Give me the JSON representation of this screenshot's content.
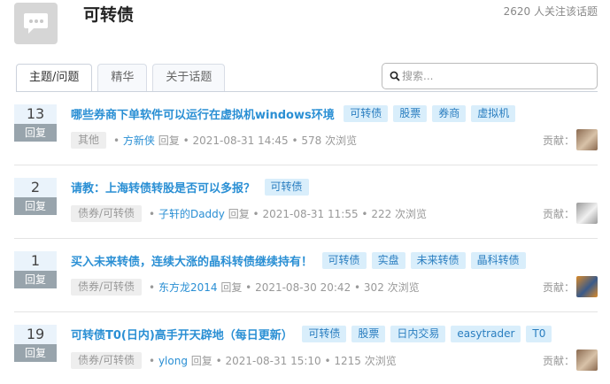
{
  "header": {
    "title": "可转债",
    "followers": "2620 人关注该话题",
    "icon": "chat-bubble-icon"
  },
  "tabs": [
    {
      "label": "主题/问题",
      "active": true
    },
    {
      "label": "精华",
      "active": false
    },
    {
      "label": "关于话题",
      "active": false
    }
  ],
  "search": {
    "placeholder": "搜索..."
  },
  "questions": [
    {
      "count": "13",
      "count_label": "回复",
      "title": "哪些券商下单软件可以运行在虚拟机windows环境",
      "tags": [
        "可转债",
        "股票",
        "券商",
        "虚拟机"
      ],
      "category": "其他",
      "author": "方新侠",
      "action": "回复",
      "time": "2021-08-31 14:45",
      "views": "578 次浏览",
      "contrib_label": "贡献：",
      "avatar_colors": [
        "#8a6a50",
        "#d8c2a8"
      ]
    },
    {
      "count": "2",
      "count_label": "回复",
      "title": "请教：上海转债转股是否可以多报？",
      "tags": [
        "可转债"
      ],
      "category": "债券/可转债",
      "author": "子轩的Daddy",
      "action": "回复",
      "time": "2021-08-31 11:55",
      "views": "222 次浏览",
      "contrib_label": "贡献：",
      "avatar_colors": [
        "#9a9a9a",
        "#f0f0f0"
      ]
    },
    {
      "count": "1",
      "count_label": "回复",
      "title": "买入未来转债，连续大涨的晶科转债继续持有！",
      "tags": [
        "可转债",
        "实盘",
        "未来转债",
        "晶科转债"
      ],
      "category": "债券/可转债",
      "author": "东方龙2014",
      "action": "回复",
      "time": "2021-08-30 20:42",
      "views": "302 次浏览",
      "contrib_label": "贡献：",
      "avatar_colors": [
        "#d98a2a",
        "#3a5a8a"
      ]
    },
    {
      "count": "19",
      "count_label": "回复",
      "title": "可转债T0(日内)高手开天辟地（每日更新）",
      "tags": [
        "可转债",
        "股票",
        "日内交易",
        "easytrader",
        "T0"
      ],
      "category": "债券/可转债",
      "author": "ylong",
      "action": "回复",
      "time": "2021-08-31 15:10",
      "views": "1215 次浏览",
      "contrib_label": "贡献：",
      "avatar_colors": [
        "#8a6a50",
        "#d8c2a8"
      ]
    }
  ]
}
